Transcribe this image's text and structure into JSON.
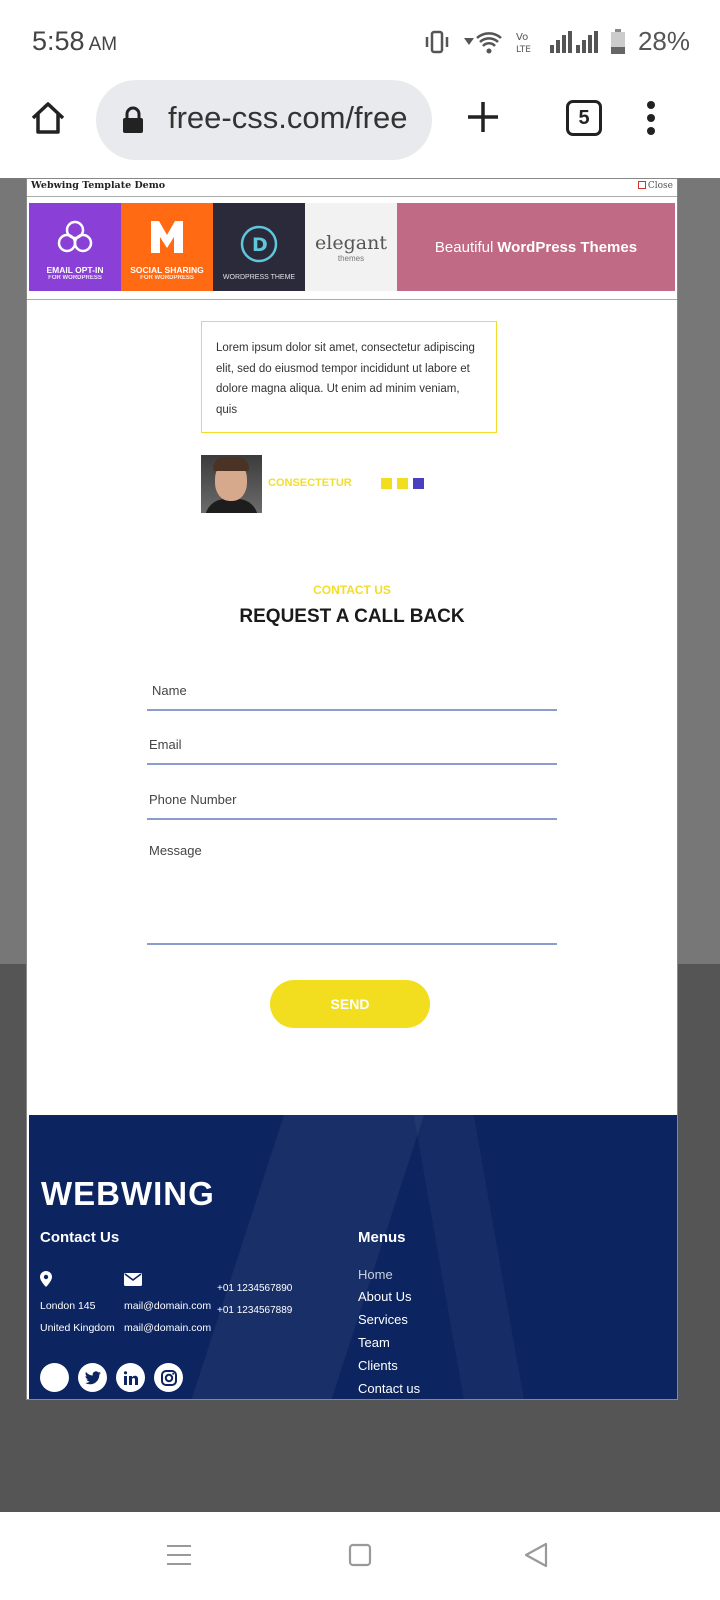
{
  "status_bar": {
    "time": "5:58",
    "ampm": "AM",
    "battery": "28%"
  },
  "browser": {
    "url": "free-css.com/free",
    "tab_count": "5"
  },
  "modal": {
    "title": "Webwing Template Demo",
    "close_label": "Close",
    "ad_banner": {
      "tiles": [
        {
          "line1": "EMAIL OPT-IN",
          "line2": "FOR WORDPRESS",
          "color": "#8a3fd6"
        },
        {
          "line1": "SOCIAL SHARING",
          "line2": "FOR WORDPRESS",
          "color": "#ff6a13"
        },
        {
          "line1": "WORDPRESS THEME",
          "line2": "",
          "color": "#2a2a3a"
        }
      ],
      "elegant_logo": "elegant",
      "elegant_sub": "themes",
      "tagline_light": "Beautiful",
      "tagline_bold": "WordPress Themes"
    },
    "testimonial_text": "Lorem ipsum dolor sit amet, consectetur adipiscing elit, sed do eiusmod tempor incididunt ut labore et dolore magna aliqua. Ut enim ad minim veniam, quis",
    "testimonial_author": "CONSECTETUR",
    "slider_dot_colors": [
      "#f2de1e",
      "#f2de1e",
      "#4a3fbf"
    ],
    "contact": {
      "kicker": "CONTACT US",
      "title": "REQUEST A CALL BACK",
      "name_placeholder": "Name",
      "email_placeholder": "Email",
      "phone_placeholder": "Phone Number",
      "message_placeholder": "Message",
      "send_label": "SEND"
    },
    "footer": {
      "brand": "WEBWING",
      "contact_heading": "Contact Us",
      "address_line1": "London 145",
      "address_line2": "United Kingdom",
      "email1": "mail@domain.com",
      "email2": "mail@domain.com",
      "phone1": "+01 1234567890",
      "phone2": "+01 1234567889",
      "menus_heading": "Menus",
      "menu_items": [
        "Home",
        "About Us",
        "Services",
        "Team",
        "Clients",
        "Contact us"
      ]
    }
  },
  "colors": {
    "accent_yellow": "#f2de1e",
    "footer_navy": "#0c2460"
  }
}
